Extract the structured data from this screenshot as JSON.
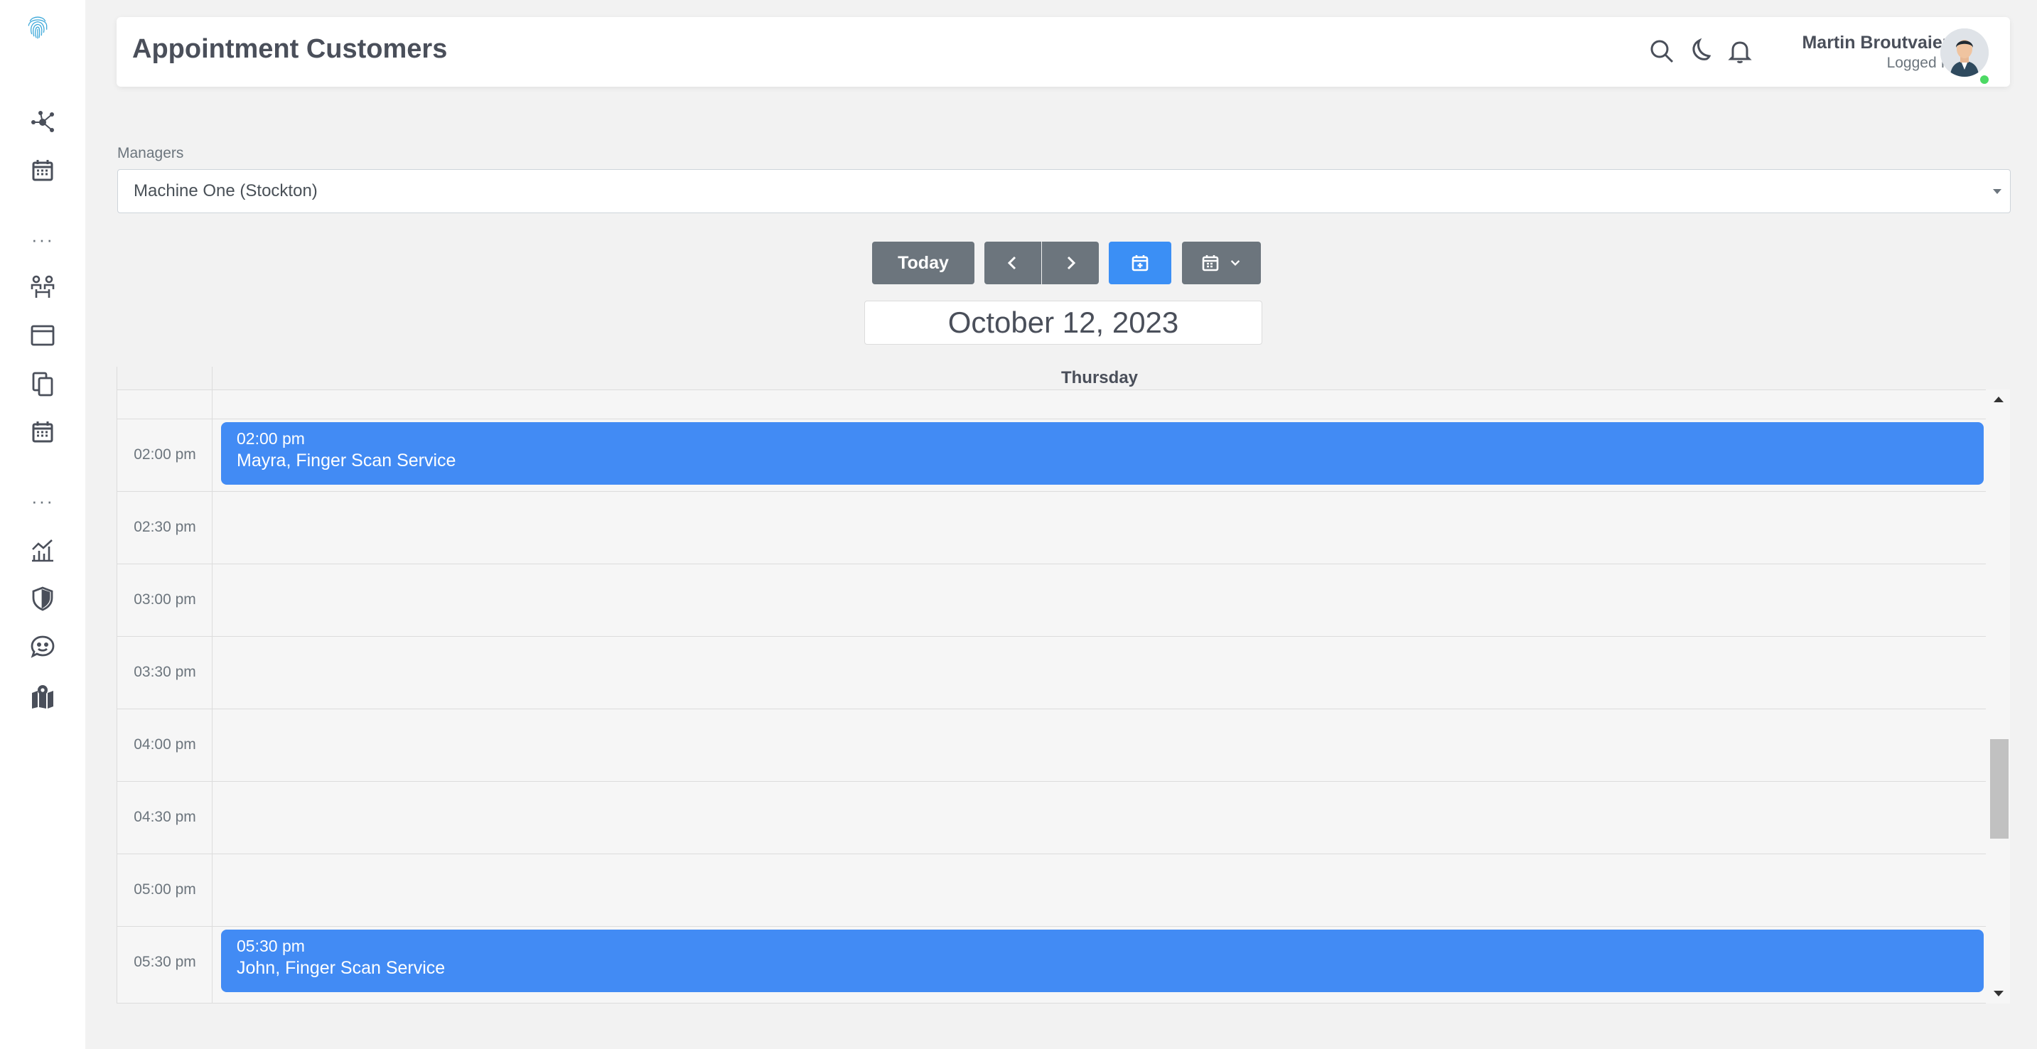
{
  "app": {
    "title": "Appointment Customers"
  },
  "sidebar": {
    "logo_icon": "fingerprint-icon",
    "items": [
      {
        "icon": "network-icon"
      },
      {
        "icon": "calendar-icon"
      },
      {
        "icon": "team-icon"
      },
      {
        "icon": "browser-window-icon"
      },
      {
        "icon": "copy-documents-icon"
      },
      {
        "icon": "calendar-grid-icon"
      },
      {
        "icon": "chart-icon"
      },
      {
        "icon": "shield-icon"
      },
      {
        "icon": "chat-icon"
      },
      {
        "icon": "map-pin-icon"
      }
    ],
    "separator": "···"
  },
  "header": {
    "user_name": "Martin Broutvaien",
    "user_status": "Logged In",
    "icons": [
      "search-icon",
      "moon-icon",
      "bell-icon"
    ],
    "online_color": "#4cd964"
  },
  "filters": {
    "managers_label": "Managers",
    "managers_value": "Machine One (Stockton)"
  },
  "toolbar": {
    "today_label": "Today",
    "prev_icon": "chevron-left-icon",
    "next_icon": "chevron-right-icon",
    "add_icon": "calendar-plus-icon",
    "view_icon": "calendar-view-icon",
    "dropdown_icon": "chevron-down-icon",
    "accent_color": "#3b8ff5",
    "gray_color": "#6c757d"
  },
  "calendar": {
    "date": "October 12, 2023",
    "day": "Thursday",
    "slots": [
      "02:00 pm",
      "02:30 pm",
      "03:00 pm",
      "03:30 pm",
      "04:00 pm",
      "04:30 pm",
      "05:00 pm",
      "05:30 pm"
    ],
    "events": [
      {
        "time": "02:00 pm",
        "title": "Mayra, Finger Scan Service"
      },
      {
        "time": "05:30 pm",
        "title": "John, Finger Scan Service"
      }
    ],
    "event_color": "#428bf4"
  }
}
